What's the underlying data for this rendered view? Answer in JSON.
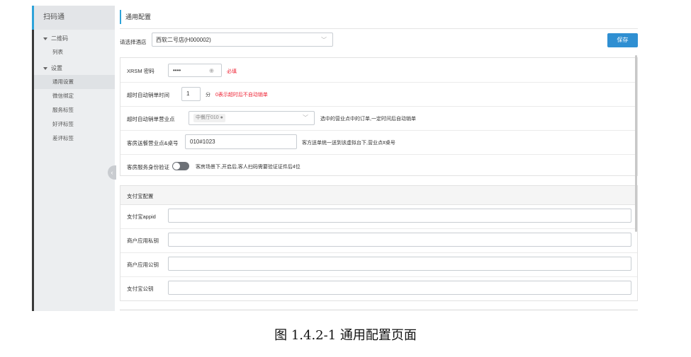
{
  "sidebar": {
    "title": "扫码通",
    "groups": [
      {
        "label": "二维码",
        "items": [
          "列表"
        ]
      },
      {
        "label": "设置",
        "items": [
          "通用设置",
          "微信绑定",
          "服务标签",
          "好评标签",
          "差评标签"
        ]
      }
    ],
    "active_item": "通用设置"
  },
  "page": {
    "title": "通用配置",
    "store_label": "请选择酒店",
    "store_value": "西软二号店(H000002)",
    "save_label": "保存"
  },
  "settings": {
    "xrsm_label": "XRSM 密码",
    "xrsm_value": "••••",
    "required_note": "必填",
    "timeout_label": "超时自动销单时间",
    "timeout_value": "1",
    "timeout_unit": "分",
    "timeout_note": "0表示超时后不自动销单",
    "outlet_label": "超时自动销单营业点",
    "outlet_tag": "中餐厅010",
    "outlet_note": "选中的营业点中的订单,一定时间后自动销单",
    "room_label": "客房送餐营业点&桌号",
    "room_value": "010#1023",
    "room_note": "客方送单统一送到该虚拟台下,营业点#桌号",
    "verify_label": "客房服务身份验证",
    "verify_note": "客房场景下,开启后,客人扫码需要验证证件后4位",
    "verify_on": false
  },
  "alipay": {
    "section_title": "支付宝配置",
    "fields": [
      {
        "label": "支付宝appid",
        "value": ""
      },
      {
        "label": "商户应用私钥",
        "value": ""
      },
      {
        "label": "商户应用公钥",
        "value": ""
      },
      {
        "label": "支付宝公钥",
        "value": ""
      }
    ]
  },
  "caption": "图 1.4.2-1  通用配置页面",
  "colors": {
    "accent": "#2fa3d9",
    "button": "#2f8fd2",
    "required": "#ee2233"
  }
}
